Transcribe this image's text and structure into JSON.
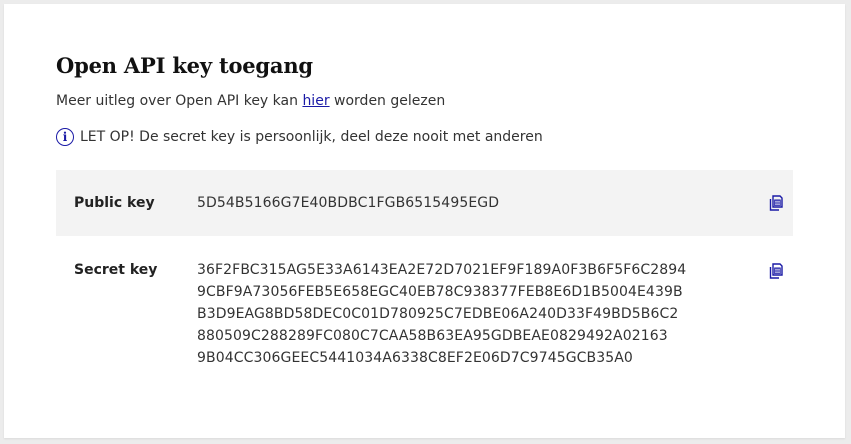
{
  "title": "Open API key toegang",
  "intro": {
    "before": "Meer uitleg over Open API key kan ",
    "link": "hier",
    "after": " worden gelezen"
  },
  "notice": {
    "icon": "info-icon",
    "text": "LET OP! De secret key is persoonlijk, deel deze nooit met anderen"
  },
  "public_key": {
    "label": "Public key",
    "value": "5D54B5166G7E40BDBC1FGB6515495EGD",
    "copy_icon": "copy-icon"
  },
  "secret_key": {
    "label": "Secret key",
    "lines": [
      "36F2FBC315AG5E33A6143EA2E72D7021EF9F189A0F3B6F5F6C2894",
      "9CBF9A73056FEB5E658EGC40EB78C938377FEB8E6D1B5004E439B",
      "B3D9EAG8BD58DEC0C01D780925C7EDBE06A240D33F49BD5B6C2",
      "880509C288289FC080C7CAA58B63EA95GDBEAE0829492A02163",
      "9B04CC306GEEC5441034A6338C8EF2E06D7C9745GCB35A0"
    ],
    "copy_icon": "copy-icon"
  },
  "colors": {
    "accent": "#1a1aa6",
    "row_background": "#f3f3f3",
    "page_background": "#ececec"
  }
}
